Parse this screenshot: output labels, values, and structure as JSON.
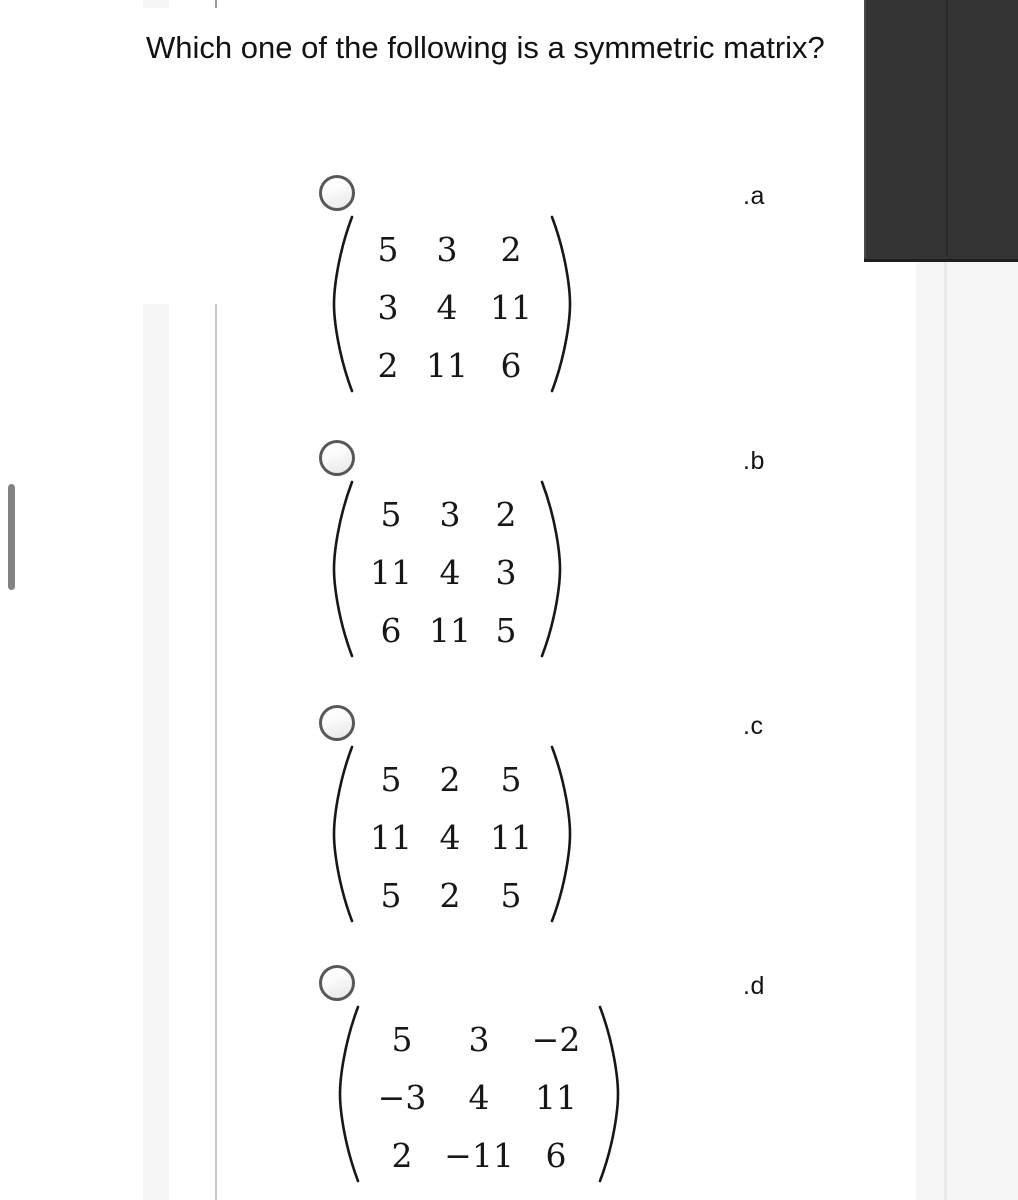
{
  "question": {
    "text": "Which one of the following is a symmetric matrix?"
  },
  "options": [
    {
      "label": ".a",
      "radio_name": "option-a-radio",
      "selected": false,
      "matrix": [
        [
          "5",
          "3",
          "2"
        ],
        [
          "3",
          "4",
          "11"
        ],
        [
          "2",
          "11",
          "6"
        ]
      ]
    },
    {
      "label": ".b",
      "radio_name": "option-b-radio",
      "selected": false,
      "matrix": [
        [
          "5",
          "3",
          "2"
        ],
        [
          "11",
          "4",
          "3"
        ],
        [
          "6",
          "11",
          "5"
        ]
      ]
    },
    {
      "label": ".c",
      "radio_name": "option-c-radio",
      "selected": false,
      "matrix": [
        [
          "5",
          "2",
          "5"
        ],
        [
          "11",
          "4",
          "11"
        ],
        [
          "5",
          "2",
          "5"
        ]
      ]
    },
    {
      "label": ".d",
      "radio_name": "option-d-radio",
      "selected": false,
      "matrix": [
        [
          "5",
          "3",
          "−2"
        ],
        [
          "−3",
          "4",
          "11"
        ],
        [
          "2",
          "−11",
          "6"
        ]
      ]
    }
  ],
  "colors": {
    "page_background": "#ffffff",
    "text": "#121212",
    "gutter_strip": "#f6f6f6",
    "vertical_rule": "#c9c9c9",
    "dark_panel": "#343434",
    "scrollbar_thumb": "#838383",
    "radio_border": "#585858"
  }
}
